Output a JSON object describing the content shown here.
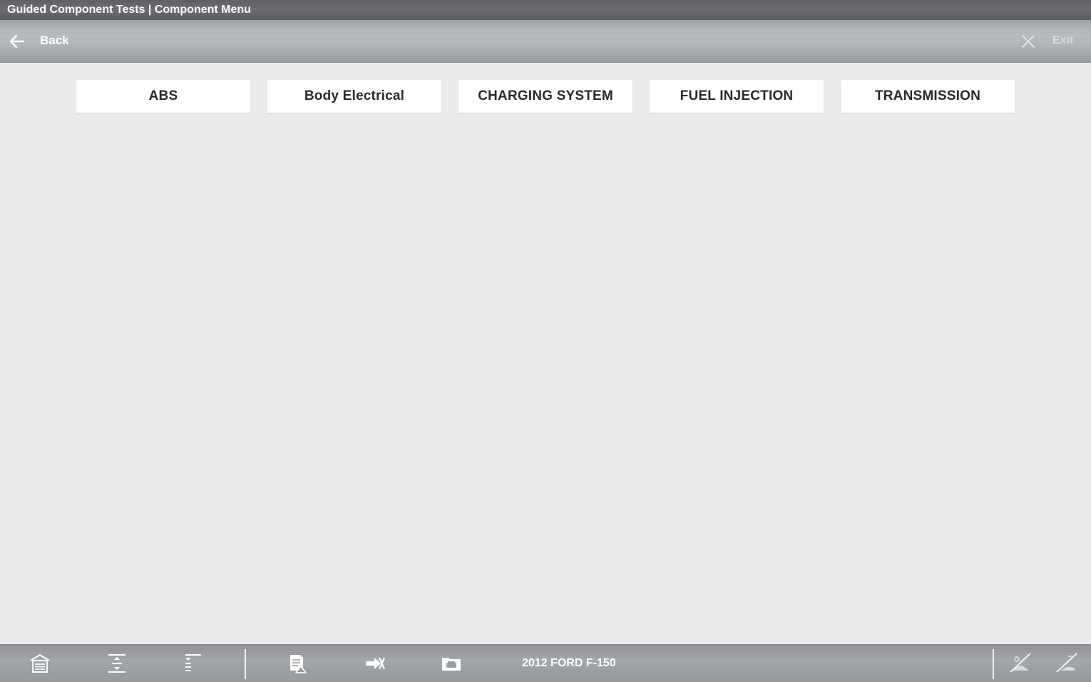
{
  "title_bar": {
    "title": "Guided Component Tests | Component Menu"
  },
  "nav": {
    "back_label": "Back",
    "back_icon": "arrow-left-icon",
    "exit_label": "Exit",
    "exit_icon": "close-icon"
  },
  "menu": {
    "items": [
      {
        "label": "ABS"
      },
      {
        "label": "Body Electrical"
      },
      {
        "label": "CHARGING SYSTEM"
      },
      {
        "label": "FUEL INJECTION"
      },
      {
        "label": "TRANSMISSION"
      }
    ]
  },
  "bottom_bar": {
    "vehicle": "2012 FORD F-150",
    "icons": [
      "garage-home-icon",
      "expand-icon",
      "collapse-list-icon",
      "report-icon",
      "send-to-icon",
      "vehicle-folder-icon",
      "scope-disabled-icon",
      "meter-disabled-icon"
    ]
  },
  "colors": {
    "background": "#ebebeb",
    "button_bg": "#ffffff",
    "button_text": "#2a2a2a",
    "bar_text": "#ffffff",
    "exit_text": "#d8dadd"
  }
}
